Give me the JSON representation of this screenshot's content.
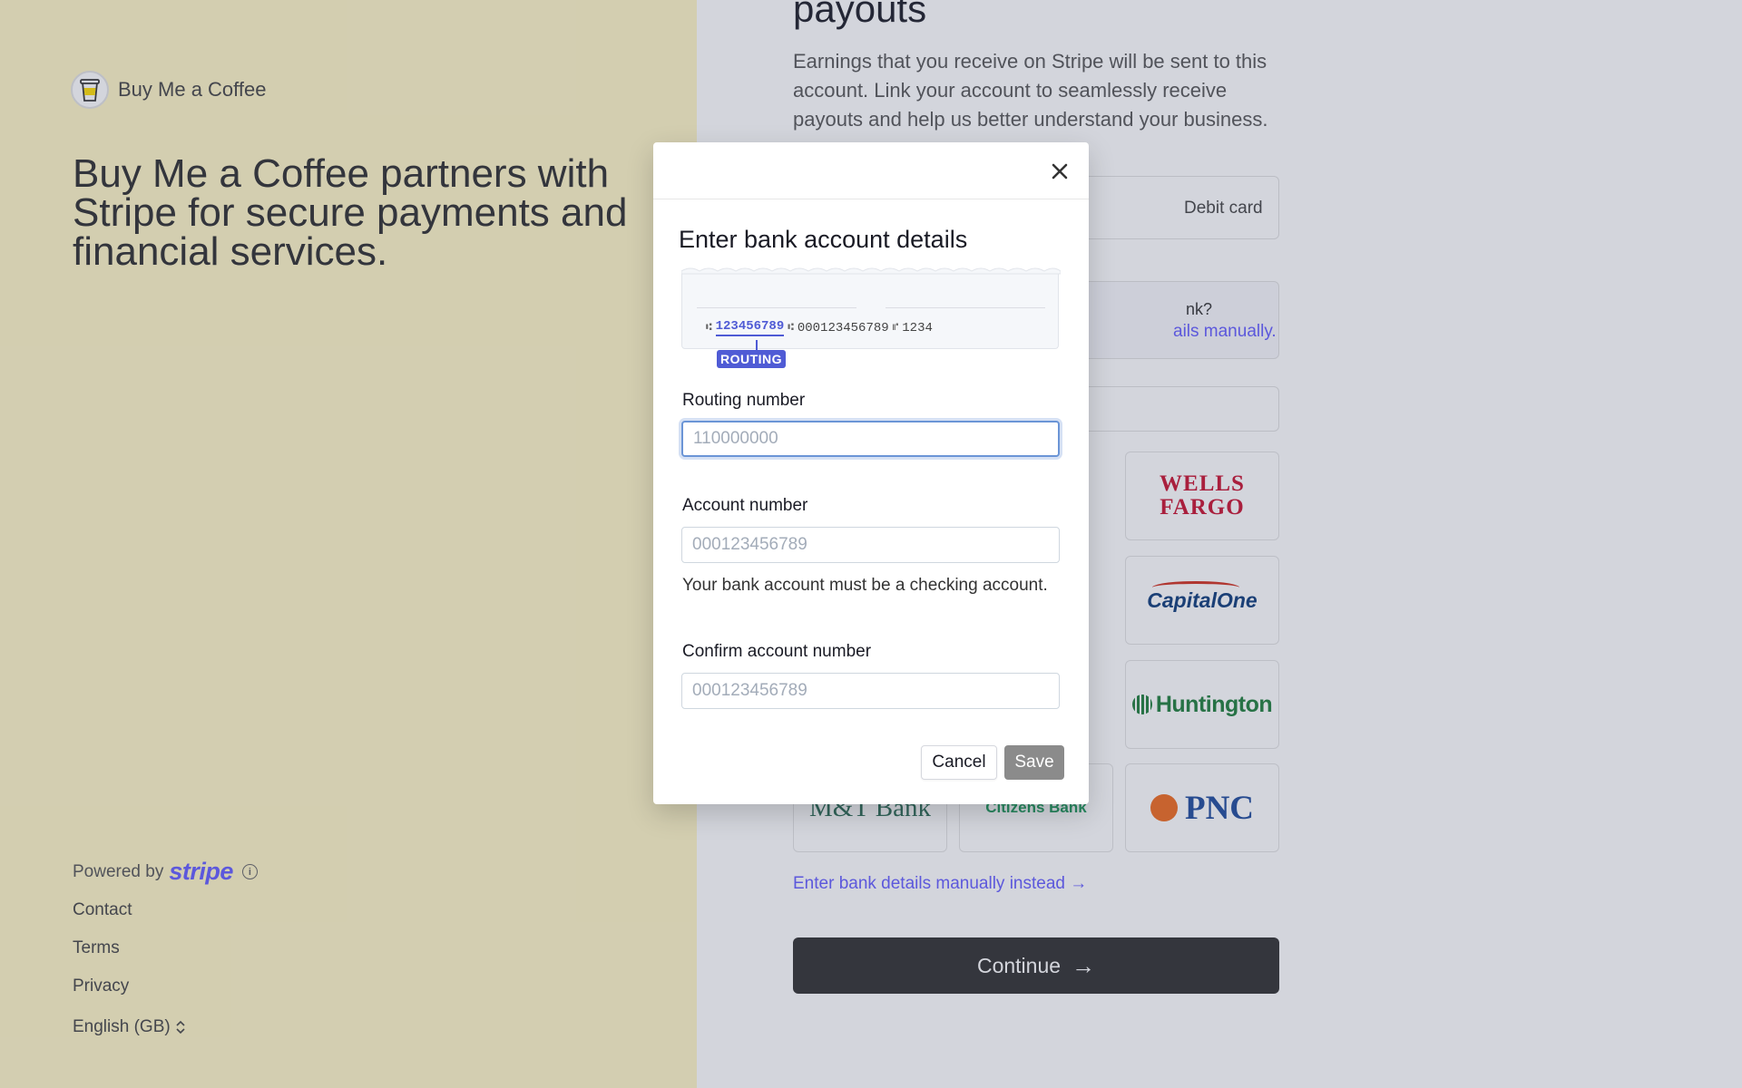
{
  "brand": {
    "name": "Buy Me a Coffee",
    "logo_icon": "coffee-cup-icon"
  },
  "left_panel": {
    "headline": "Buy Me a Coffee partners with Stripe for secure payments and financial services.",
    "powered_by": "Powered by",
    "powered_brand": "stripe",
    "footer_links": [
      "Contact",
      "Terms",
      "Privacy"
    ],
    "language": "English (GB)"
  },
  "right_panel": {
    "title": "payouts",
    "description": "Earnings that you receive on Stripe will be sent to this account. Link your account to seamlessly receive payouts and help us better understand your business.",
    "tab_debit": "Debit card",
    "info_question": "nk?",
    "info_link": "ails manually.",
    "banks": {
      "wells_fargo": "WELLS FARGO",
      "capital_one": "CapitalOne",
      "huntington": "Huntington",
      "mt_bank": "M&T Bank",
      "citizens": "Citizens Bank",
      "pnc": "PNC"
    },
    "manual_link": "Enter bank details manually instead",
    "continue_label": "Continue"
  },
  "modal": {
    "title": "Enter bank account details",
    "check": {
      "routing_number": "123456789",
      "account_number": "000123456789",
      "check_number": "1234",
      "tag": "ROUTING"
    },
    "routing": {
      "label": "Routing number",
      "placeholder": "110000000",
      "value": ""
    },
    "account": {
      "label": "Account number",
      "placeholder": "000123456789",
      "value": "",
      "help": "Your bank account must be a checking account."
    },
    "confirm": {
      "label": "Confirm account number",
      "placeholder": "000123456789",
      "value": ""
    },
    "cancel_label": "Cancel",
    "save_label": "Save"
  },
  "colors": {
    "brand_panel": "#fff6c6",
    "stripe": "#635bff",
    "routing_accent": "#4f5bd5",
    "save_disabled": "#8b8b8b",
    "continue_disabled": "#2e2e2e"
  }
}
